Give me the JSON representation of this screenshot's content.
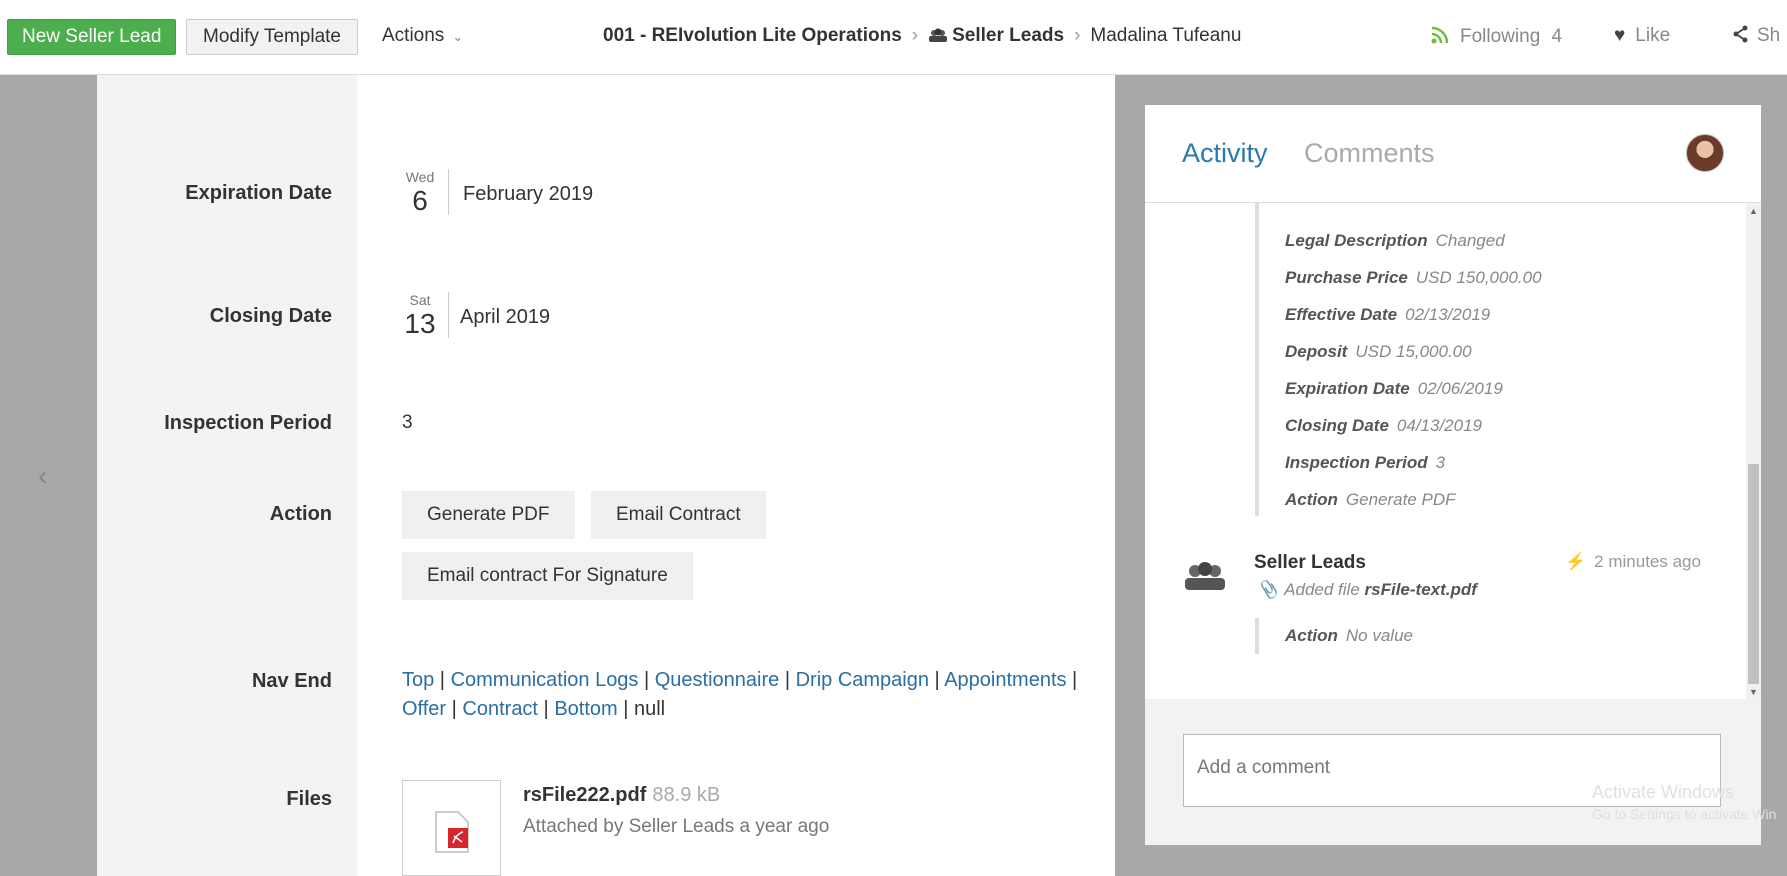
{
  "topbar": {
    "new_seller_lead": "New Seller Lead",
    "modify_template": "Modify Template",
    "actions": "Actions",
    "breadcrumb": {
      "workspace": "001 - REIvolution Lite Operations",
      "app": "Seller Leads",
      "item": "Madalina Tufeanu"
    },
    "following_label": "Following",
    "following_count": "4",
    "like_label": "Like",
    "share_label": "Sh"
  },
  "fields": {
    "expiration_label": "Expiration Date",
    "expiration_dow": "Wed",
    "expiration_day": "6",
    "expiration_month_year": "February 2019",
    "closing_label": "Closing Date",
    "closing_dow": "Sat",
    "closing_day": "13",
    "closing_month_year": "April 2019",
    "inspection_label": "Inspection Period",
    "inspection_value": "3",
    "action_label": "Action",
    "action_buttons": [
      "Generate PDF",
      "Email Contract",
      "Email contract For Signature"
    ],
    "nav_end_label": "Nav End",
    "nav_links": [
      "Top",
      "Communication Logs",
      "Questionnaire",
      "Drip Campaign",
      "Appointments",
      "Offer",
      "Contract",
      "Bottom"
    ],
    "nav_tail": "null",
    "files_label": "Files",
    "file_name": "rsFile222.pdf",
    "file_size": "88.9 kB",
    "file_meta": "Attached by Seller Leads a year ago"
  },
  "activity": {
    "tab_activity": "Activity",
    "tab_comments": "Comments",
    "changes": [
      {
        "k": "Legal Description",
        "v": "Changed"
      },
      {
        "k": "Purchase Price",
        "v": "USD 150,000.00"
      },
      {
        "k": "Effective Date",
        "v": "02/13/2019"
      },
      {
        "k": "Deposit",
        "v": "USD 15,000.00"
      },
      {
        "k": "Expiration Date",
        "v": "02/06/2019"
      },
      {
        "k": "Closing Date",
        "v": "04/13/2019"
      },
      {
        "k": "Inspection Period",
        "v": "3"
      },
      {
        "k": "Action",
        "v": "Generate PDF"
      }
    ],
    "entry_title": "Seller Leads",
    "entry_time": "2 minutes ago",
    "entry_file_prefix": "Added file",
    "entry_file_name": "rsFile-text.pdf",
    "entry_action_key": "Action",
    "entry_action_value": "No value",
    "comment_placeholder": "Add a comment"
  },
  "windows": {
    "activate_title": "Activate Windows",
    "activate_sub": "Go to Settings to activate Win"
  },
  "colors": {
    "accent_green": "#4cae4c",
    "link_blue": "#2a6ea6",
    "tab_blue": "#2a7ab0"
  }
}
